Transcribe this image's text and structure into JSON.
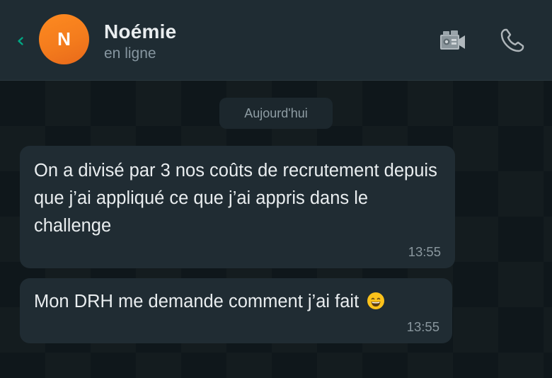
{
  "header": {
    "contact_name": "Noémie",
    "avatar_initial": "N",
    "status": "en ligne",
    "colors": {
      "accent": "#00a884",
      "avatar_orange": "#f47c1d",
      "header_bg": "#1f2c33"
    },
    "icons": [
      "back-chevron-icon",
      "video-call-icon",
      "phone-icon"
    ]
  },
  "chat": {
    "date_label": "Aujourd'hui",
    "messages": [
      {
        "text": "On a divisé par 3 nos coûts de recrutement depuis que j’ai appliqué ce que j’ai appris dans le challenge",
        "time": "13:55"
      },
      {
        "text": "Mon DRH me demande comment j’ai fait",
        "emoji": "grinning-face-with-smiling-eyes-icon",
        "time": "13:55"
      }
    ]
  }
}
